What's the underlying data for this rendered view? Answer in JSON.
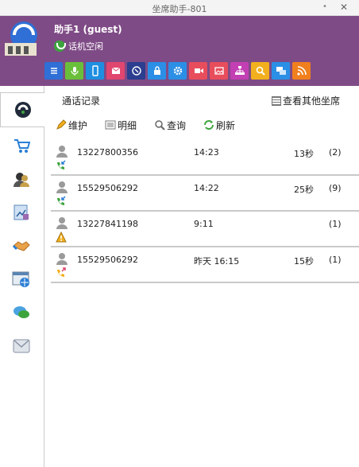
{
  "window": {
    "title": "坐席助手-801",
    "minimize_label": "•",
    "close_label": "✕"
  },
  "header": {
    "username": "助手1 (guest)",
    "status": "话机空闲",
    "apps": [
      {
        "name": "list-icon",
        "color": "#2f6fd6"
      },
      {
        "name": "microphone-icon",
        "color": "#6abf3a"
      },
      {
        "name": "mobile-icon",
        "color": "#1e8fe0"
      },
      {
        "name": "mail-icon",
        "color": "#e0466f"
      },
      {
        "name": "phone-icon",
        "color": "#2b3e8f"
      },
      {
        "name": "lock-icon",
        "color": "#2b8fe6"
      },
      {
        "name": "gear-icon",
        "color": "#2b8fe6"
      },
      {
        "name": "video-icon",
        "color": "#e84d5b"
      },
      {
        "name": "picture-icon",
        "color": "#e84d5b"
      },
      {
        "name": "org-chart-icon",
        "color": "#c23fb4"
      },
      {
        "name": "search-icon",
        "color": "#f2b01e"
      },
      {
        "name": "chat-icon",
        "color": "#2b8fe6"
      },
      {
        "name": "rss-icon",
        "color": "#f07f1e"
      }
    ]
  },
  "sidebar": {
    "items": [
      {
        "name": "sidebar-item-call-records"
      },
      {
        "name": "sidebar-item-cart"
      },
      {
        "name": "sidebar-item-contacts"
      },
      {
        "name": "sidebar-item-reports"
      },
      {
        "name": "sidebar-item-handshake"
      },
      {
        "name": "sidebar-item-browser"
      },
      {
        "name": "sidebar-item-messages"
      },
      {
        "name": "sidebar-item-mail"
      }
    ]
  },
  "main": {
    "section_title": "通话记录",
    "view_others_label": "查看其他坐席",
    "toolbar": {
      "maintain": "维护",
      "details": "明细",
      "query": "查询",
      "refresh": "刷新"
    },
    "records": [
      {
        "number": "13227800356",
        "time": "14:23",
        "duration": "13秒",
        "count": "(2)",
        "type": "incoming"
      },
      {
        "number": "15529506292",
        "time": "14:22",
        "duration": "25秒",
        "count": "(9)",
        "type": "incoming"
      },
      {
        "number": "13227841198",
        "time": "9:11",
        "duration": "",
        "count": "(1)",
        "type": "missed"
      },
      {
        "number": "15529506292",
        "time": "昨天 16:15",
        "duration": "15秒",
        "count": "(1)",
        "type": "outgoing"
      }
    ]
  }
}
